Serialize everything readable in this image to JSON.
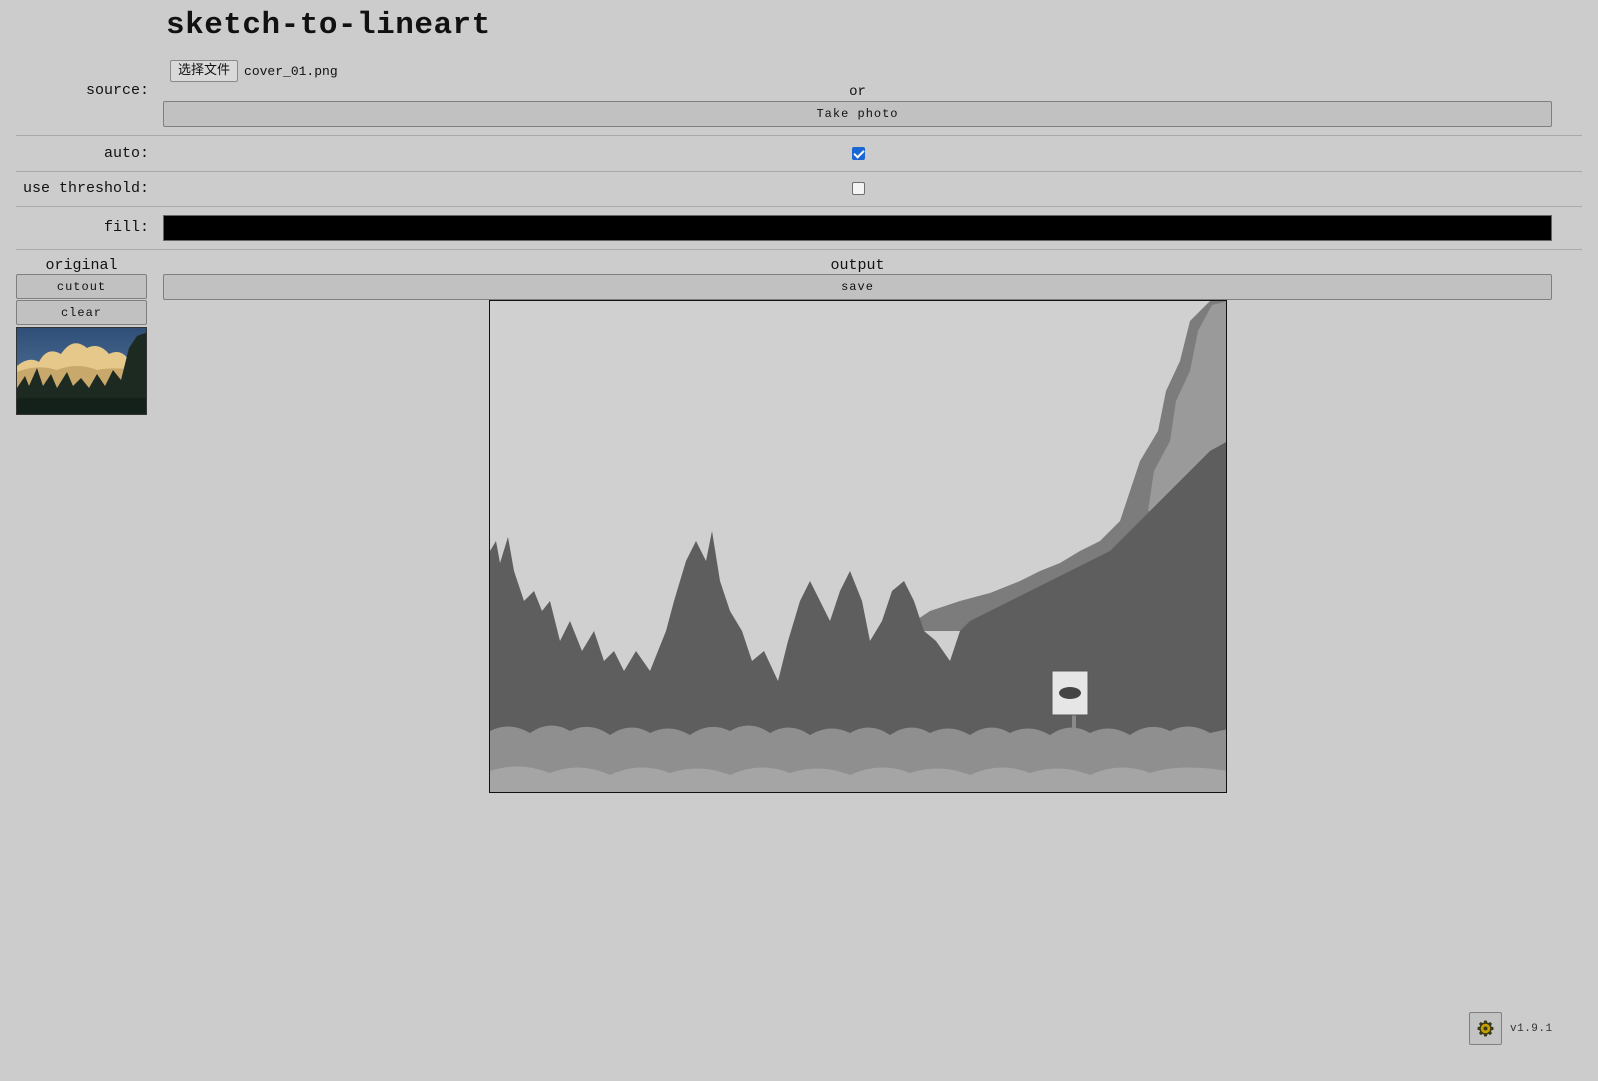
{
  "app": {
    "title": "sketch-to-lineart",
    "version": "v1.9.1"
  },
  "source": {
    "label": "source:",
    "file_button_label": "选择文件",
    "file_name": "cover_01.png",
    "or_text": "or",
    "take_photo_label": "Take photo"
  },
  "auto": {
    "label": "auto:",
    "checked": true
  },
  "threshold": {
    "label": "use threshold:",
    "checked": false
  },
  "fill": {
    "label": "fill:",
    "color": "#000000"
  },
  "original": {
    "heading": "original",
    "cutout_label": "cutout",
    "clear_label": "clear"
  },
  "output": {
    "heading": "output",
    "save_label": "save"
  },
  "icons": {
    "settings": "gear-icon"
  },
  "colors": {
    "background": "#cccccc",
    "button": "#c1c1c1",
    "checkbox_accent": "#1a66d2"
  }
}
